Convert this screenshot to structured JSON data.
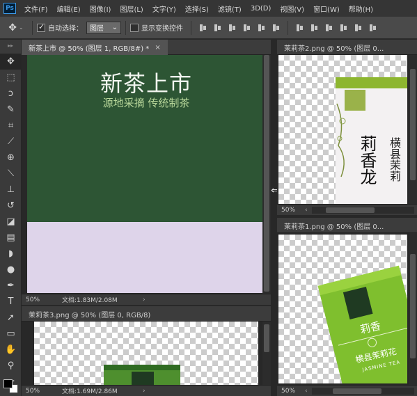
{
  "app": {
    "logo": "Ps"
  },
  "menu": [
    "文件(F)",
    "编辑(E)",
    "图像(I)",
    "图层(L)",
    "文字(Y)",
    "选择(S)",
    "滤镜(T)",
    "3D(D)",
    "视图(V)",
    "窗口(W)",
    "帮助(H)"
  ],
  "options": {
    "auto_select_label": "自动选择：",
    "auto_select_value": "图层",
    "show_transform_label": "显示变换控件",
    "move_icon": "move-tool-icon"
  },
  "tools": [
    "move-tool-icon",
    "marquee-tool-icon",
    "lasso-tool-icon",
    "quick-select-tool-icon",
    "crop-tool-icon",
    "eyedropper-tool-icon",
    "healing-brush-icon",
    "brush-tool-icon",
    "clone-stamp-icon",
    "history-brush-icon",
    "eraser-tool-icon",
    "gradient-tool-icon",
    "blur-tool-icon",
    "dodge-tool-icon",
    "pen-tool-icon",
    "type-tool-icon",
    "path-select-icon",
    "rectangle-tool-icon",
    "hand-tool-icon",
    "zoom-tool-icon",
    "more-tools-icon"
  ],
  "docs": {
    "main": {
      "tab": "新茶上市 @ 50% (图层 1, RGB/8#) *",
      "close": "×",
      "zoom": "50%",
      "info": "文档:1.83M/2.08M",
      "headline": "新茶上市",
      "subline": "源地采摘 传统制茶",
      "colors": {
        "top": "#2d5534",
        "bottom": "#ded4ea"
      }
    },
    "doc2": {
      "tab": "茉莉茶2.png @ 50% (图层 0...",
      "zoom": "50%",
      "tin_text_big": "莉香龙",
      "tin_text_side": "横县茉莉"
    },
    "doc3": {
      "tab": "茉莉茶1.png @ 50% (图层 0...",
      "zoom": "50%",
      "tin_text_big": "莉香",
      "tin_text_line": "横县茉莉花",
      "tin_text_en": "JASMINE TEA"
    },
    "doc4": {
      "tab": "茉莉茶3.png @ 50% (图层 0, RGB/8)",
      "zoom": "50%",
      "info": "文档:1.69M/2.86M"
    }
  }
}
